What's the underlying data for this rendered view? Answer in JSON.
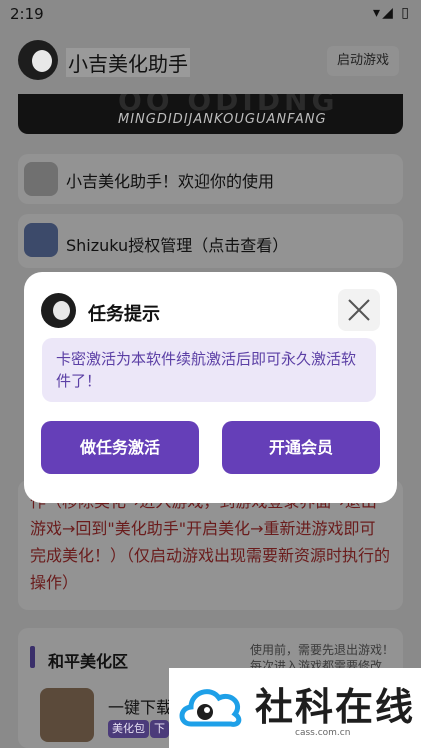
{
  "status": {
    "time": "2:19",
    "icons": "▾◢ ▯"
  },
  "app": {
    "title": "小吉美化助手",
    "launch_label": "启动游戏"
  },
  "banner": {
    "big_text": "OO ODIDNG",
    "sub_text": "MINGDIDIJANKOUGUANFANG"
  },
  "rows": [
    {
      "label": "小吉美化助手！欢迎你的使用"
    },
    {
      "label": "Shizuku授权管理（点击查看）"
    }
  ],
  "behind_text": "作（移除美化→进入游戏，到游戏登录界面→退出游戏→回到\"美化助手\"开启美化→重新进游戏即可完成美化！）（仅启动游戏出现需要新资源时执行的操作）",
  "section": {
    "label": "和平美化区",
    "hint": "使用前，需要先退出游戏！每次进入游戏都需要修改",
    "game_title": "一键下载",
    "tags": [
      "美化包",
      "下"
    ]
  },
  "dialog": {
    "title": "任务提示",
    "message": "卡密激活为本软件续航激活后即可永久激活软件了！",
    "btn_task": "做任务激活",
    "btn_vip": "开通会员"
  },
  "watermark": {
    "brand": "社科在线",
    "url": "cass.com.cn"
  },
  "colors": {
    "accent": "#653fb8",
    "message_bg": "#ece7f8",
    "message_text": "#5b3fa5",
    "overlay": "#8a8a8a"
  }
}
